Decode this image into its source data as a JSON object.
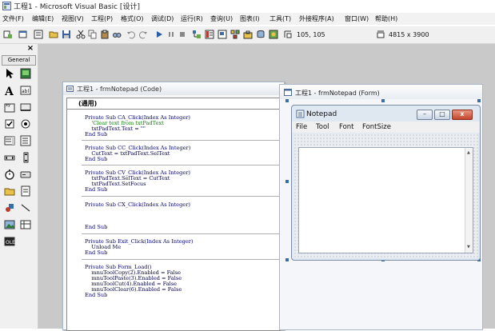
{
  "window": {
    "title": "工程1 - Microsoft Visual Basic [设计]"
  },
  "menubar": {
    "items": [
      "文件(F)",
      "编辑(E)",
      "视图(V)",
      "工程(P)",
      "格式(O)",
      "调试(D)",
      "运行(R)",
      "查询(U)",
      "图表(I)",
      "工具(T)",
      "外接程序(A)",
      "窗口(W)",
      "帮助(H)"
    ]
  },
  "toolbar": {
    "position": "105, 105",
    "size": "4815 x 3900"
  },
  "toolbox": {
    "close": "×",
    "tab_label": "General"
  },
  "code_window": {
    "title": "工程1 - frmNotepad (Code)",
    "object_combo": "(通用)",
    "procedures": [
      {
        "lines": [
          "Private Sub CA_Click(Index As Integer)",
          "    'Clear text from txtPadText",
          "    txtPadText.Text = \"\"",
          "End Sub"
        ]
      },
      {
        "lines": [
          "Private Sub CC_Click(Index As Integer)",
          "    CutText = txtPadText.SelText",
          "End Sub"
        ]
      },
      {
        "lines": [
          "Private Sub CV_Click(Index As Integer)",
          "    txtPadText.SelText = CutText",
          "    txtPadText.SetFocus",
          "End Sub"
        ]
      },
      {
        "lines": [
          "Private Sub CX_Click(Index As Integer)",
          "",
          "",
          "",
          "End Sub"
        ]
      },
      {
        "lines": [
          "Private Sub Exit_Click(Index As Integer)",
          "    Unload Me",
          "End Sub"
        ]
      },
      {
        "lines": [
          "Private Sub Form_Load()",
          "    mnuToolCopy(2).Enabled = False",
          "    mnuToolPaste(3).Enabled = False",
          "    mnuToolCut(4).Enabled = False",
          "    mnuToolClear(6).Enabled = False",
          "End Sub"
        ]
      }
    ]
  },
  "form_window": {
    "title": "工程1 - frmNotepad (Form)"
  },
  "notepad": {
    "title": "Notepad",
    "minimize": "–",
    "maximize": "□",
    "close": "x",
    "menu": [
      "File",
      "Tool",
      "Font",
      "FontSize"
    ],
    "scroll_up": "▲",
    "scroll_down": "▼"
  },
  "colors": {
    "code_keyword": "#00007a",
    "code_comment": "#0b7a0b",
    "mdi_background": "#c9c9c9",
    "selection_handle": "#3a6ea8"
  }
}
